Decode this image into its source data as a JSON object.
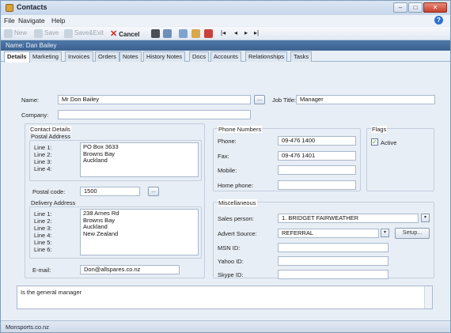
{
  "window": {
    "title": "Contacts",
    "min_glyph": "–",
    "max_glyph": "□",
    "close_glyph": "✕"
  },
  "menu": {
    "items": [
      "File",
      "Navigate",
      "Help"
    ],
    "help_glyph": "?"
  },
  "toolbar": {
    "new": "New",
    "save": "Save",
    "save_exit": "Save&Exit",
    "cancel": "Cancel",
    "cancel_glyph": "✕",
    "nav": [
      "|◂",
      "◂",
      "▸",
      "▸|"
    ]
  },
  "name_bar": "Name: Dan Bailey",
  "tabs": [
    "Details",
    "Marketing",
    "Invoices",
    "Orders",
    "Notes",
    "History Notes",
    "Docs",
    "Accounts",
    "Relationships",
    "Tasks"
  ],
  "form": {
    "name_label": "Name:",
    "name_value": "Mr Don Bailey",
    "job_title_label": "Job Title:",
    "job_title_value": "Manager",
    "company_label": "Company:",
    "contact_details_label": "Contact Details",
    "postal_label": "Postal Address",
    "postal_lines": [
      "Line 1:",
      "Line 2:",
      "Line 3:",
      "Line 4:"
    ],
    "postal_value": "PO Box 3633\nBrowns Bay\nAuckland",
    "postal_code_label": "Postal code:",
    "postal_code_value": "1500",
    "delivery_label": "Delivery Address",
    "delivery_lines": [
      "Line 1:",
      "Line 2:",
      "Line 3:",
      "Line 4:",
      "Line 5:",
      "Line 6:"
    ],
    "delivery_value": "238 Arnes Rd\nBrowns Bay\nAuckland\nNew Zealand",
    "email_label": "E-mail:",
    "email_value": "Don@allspares.co.nz",
    "phone_group_label": "Phone Numbers",
    "phone_label": "Phone:",
    "phone_value": "09-476 1400",
    "fax_label": "Fax:",
    "fax_value": "09-476 1401",
    "mobile_label": "Mobile:",
    "home_phone_label": "Home phone:",
    "flags_label": "Flags",
    "active_label": "Active",
    "active_checked": true,
    "active_glyph": "✓",
    "misc_label": "Miscellaneous",
    "sales_person_label": "Sales person:",
    "sales_person_value": "1. BRIDGET FAIRWEATHER",
    "advert_source_label": "Advert Source:",
    "advert_source_value": "REFERRAL",
    "setup_label": "Setup...",
    "msn_label": "MSN ID:",
    "yahoo_label": "Yahoo ID:",
    "skype_label": "Skype ID:",
    "notes_value": "Is the general manager",
    "lookup_glyph": "...",
    "dropdown_glyph": "▾"
  },
  "status": "Monsports.co.nz"
}
